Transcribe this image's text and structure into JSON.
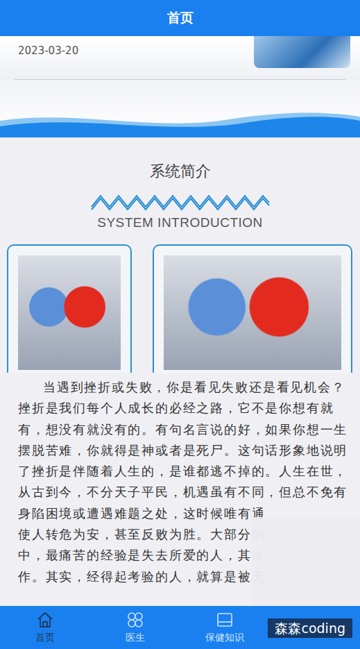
{
  "header": {
    "title": "首页"
  },
  "news": {
    "date": "2023-03-20"
  },
  "intro": {
    "title": "系统简介",
    "subtitle": "SYSTEM INTRODUCTION",
    "paragraph_lines": [
      "当遇到挫折或失败，你是看见失败还是看见机会？",
      "挫折是我们每个人成长的必经之路，它不是你想有就",
      "有，想没有就没有的。有句名言说的好，如果你想一生",
      "摆脱苦难，你就得是神或者是死尸。这句话形象地说明",
      "了挫折是伴随着人生的，是谁都逃不掉的。人生在世，",
      "从古到今，不分天子平民，机遇虽有不同，但总不免有",
      "身陷困境或遭遇难题之处，这时候唯有通",
      "使人转危为安，甚至反败为胜。大部分的",
      "中，最痛苦的经验是失去所爱的人，其次",
      "作。其实，经得起考验的人，就算是被无"
    ]
  },
  "nav": [
    {
      "label": "首页",
      "kind": "home",
      "selected": true
    },
    {
      "label": "医生",
      "kind": "doctor",
      "selected": false
    },
    {
      "label": "保健知识",
      "kind": "knowledge",
      "selected": false
    }
  ],
  "watermark": {
    "text": "森森coding"
  }
}
